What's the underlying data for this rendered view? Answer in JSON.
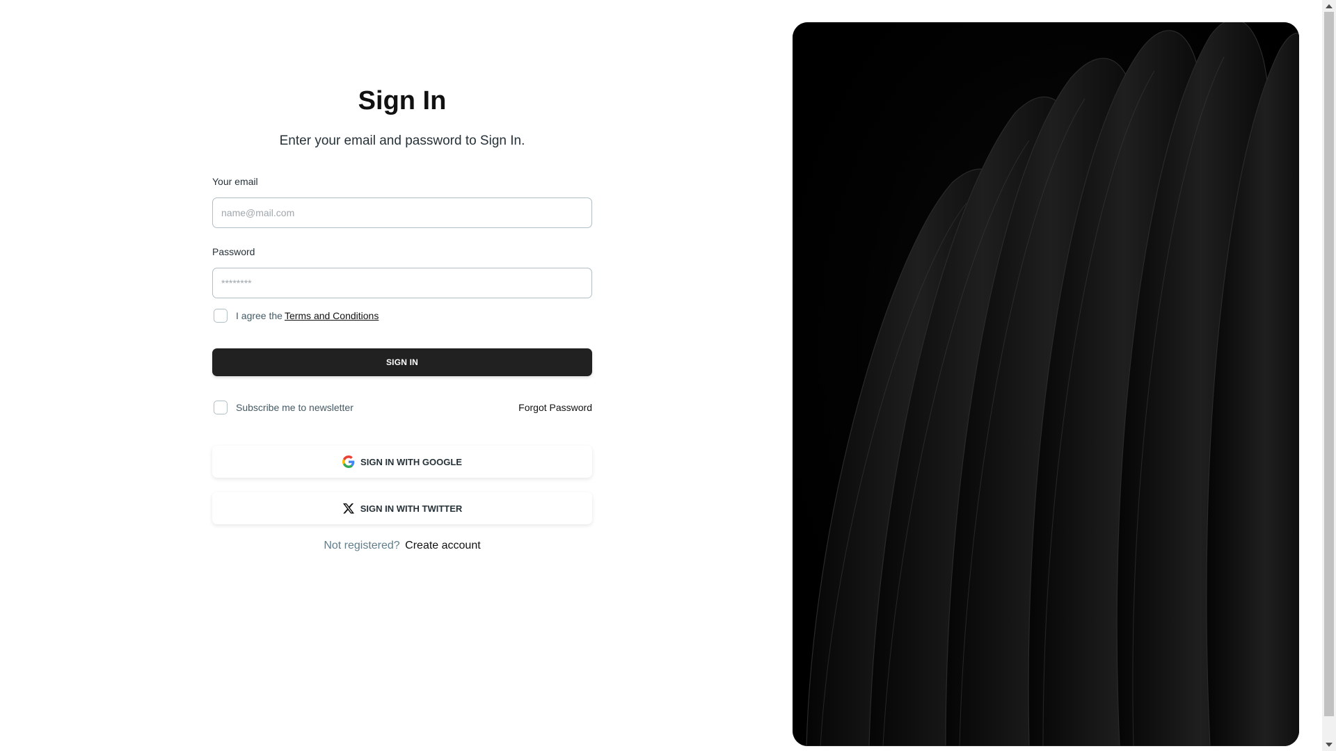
{
  "form": {
    "title": "Sign In",
    "subtitle": "Enter your email and password to Sign In.",
    "email_label": "Your email",
    "email_placeholder": "name@mail.com",
    "email_value": "",
    "password_label": "Password",
    "password_placeholder": "********",
    "password_value": "",
    "terms_prefix": "I agree the",
    "terms_link": "Terms and Conditions",
    "terms_checked": false,
    "signin_button": "SIGN IN",
    "newsletter_label": "Subscribe me to newsletter",
    "newsletter_checked": false,
    "forgot_password": "Forgot Password",
    "google_button": "SIGN IN WITH GOOGLE",
    "twitter_button": "SIGN IN WITH TWITTER",
    "register_question": "Not registered?",
    "register_link": "Create account"
  },
  "icons": {
    "google": "google-icon",
    "twitter": "x-twitter-icon"
  },
  "colors": {
    "primary_button": "#212121",
    "hero_background": "#000000",
    "muted_text": "#607d8b"
  }
}
